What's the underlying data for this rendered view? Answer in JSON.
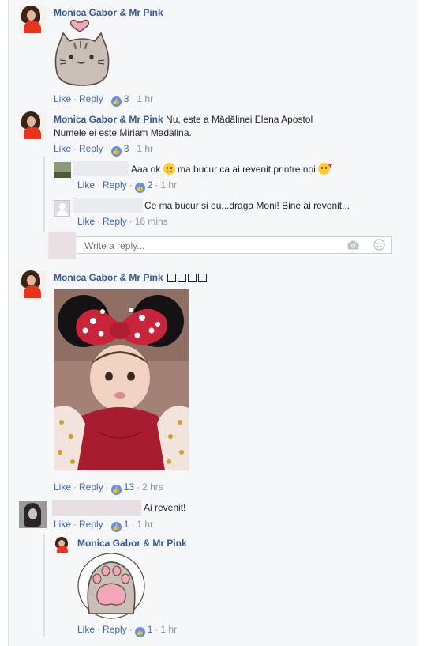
{
  "comments": [
    {
      "author": "Monica Gabor & Mr Pink",
      "text": "",
      "sticker": "pusheen-cat-heart-sticker",
      "actions": {
        "like": "Like",
        "reply": "Reply",
        "count": "3",
        "time": "1 hr"
      }
    },
    {
      "author": "Monica Gabor & Mr Pink",
      "text_line1": "Nu, este a Mădălinei Elena Apostol",
      "text_line2": "Numele ei este Miriam Madalina.",
      "actions": {
        "like": "Like",
        "reply": "Reply",
        "count": "3",
        "time": "1 hr"
      },
      "replies": [
        {
          "text_before": "Aaa ok",
          "text_after": "ma bucur ca ai revenit printre noi",
          "actions": {
            "like": "Like",
            "reply": "Reply",
            "count": "2",
            "time": "1 hr"
          }
        },
        {
          "text": "Ce ma bucur si eu...draga Moni! Bine ai revenit...",
          "actions": {
            "like": "Like",
            "reply": "Reply",
            "time": "16 mins"
          }
        }
      ],
      "reply_input": {
        "placeholder": "Write a reply...",
        "camera_icon": "camera-icon",
        "emoji_icon": "smiley-icon"
      }
    },
    {
      "author": "Monica Gabor & Mr Pink",
      "photo": "baby-with-minnie-ears-photo",
      "actions": {
        "like": "Like",
        "reply": "Reply",
        "count": "13",
        "time": "2 hrs"
      }
    },
    {
      "text": "Ai revenit!",
      "actions": {
        "like": "Like",
        "reply": "Reply",
        "count": "1",
        "time": "1 hr"
      },
      "replies": [
        {
          "author": "Monica Gabor & Mr Pink",
          "sticker": "pusheen-paw-sticker",
          "actions": {
            "like": "Like",
            "reply": "Reply",
            "count": "1",
            "time": "1 hr"
          }
        }
      ]
    }
  ],
  "colors": {
    "link": "#365899",
    "action": "#4267b2",
    "meta": "#90949c",
    "like_badge": "#5890ff",
    "panel_bg": "#f6f7f9"
  }
}
